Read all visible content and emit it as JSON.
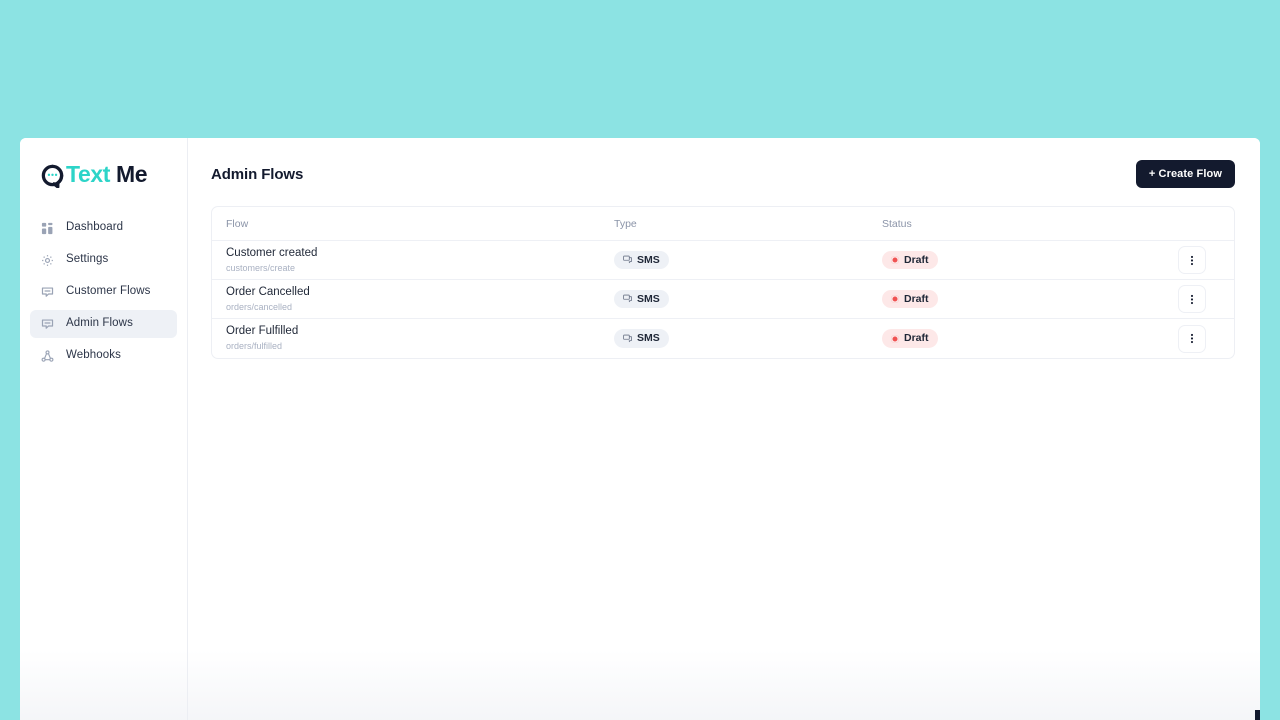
{
  "theme": {
    "background": "#8ce3e3",
    "accent_teal": "#2dd4c8",
    "dark_navy": "#131a2e",
    "status_red": "#f05252",
    "status_red_bg": "#fde8e8",
    "badge_bg": "#eef1f6"
  },
  "brand": {
    "name_part1": "Text",
    "name_part2": "Me",
    "logo_icon": "speech-bubble-icon"
  },
  "sidebar": {
    "items": [
      {
        "label": "Dashboard",
        "icon": "dashboard-grid-icon",
        "active": false
      },
      {
        "label": "Settings",
        "icon": "gear-icon",
        "active": false
      },
      {
        "label": "Customer Flows",
        "icon": "chat-flow-icon",
        "active": false
      },
      {
        "label": "Admin Flows",
        "icon": "chat-flow-icon",
        "active": true
      },
      {
        "label": "Webhooks",
        "icon": "share-nodes-icon",
        "active": false
      }
    ]
  },
  "header": {
    "title": "Admin Flows",
    "create_button": "+ Create Flow"
  },
  "table": {
    "columns": [
      "Flow",
      "Type",
      "Status"
    ],
    "rows": [
      {
        "flow_name": "Customer created",
        "flow_path": "customers/create",
        "type": "SMS",
        "type_icon": "device-chat-icon",
        "status": "Draft",
        "status_icon": "status-dot-icon",
        "action_icon": "kebab-menu-icon"
      },
      {
        "flow_name": "Order Cancelled",
        "flow_path": "orders/cancelled",
        "type": "SMS",
        "type_icon": "device-chat-icon",
        "status": "Draft",
        "status_icon": "status-dot-icon",
        "action_icon": "kebab-menu-icon"
      },
      {
        "flow_name": "Order Fulfilled",
        "flow_path": "orders/fulfilled",
        "type": "SMS",
        "type_icon": "device-chat-icon",
        "status": "Draft",
        "status_icon": "status-dot-icon",
        "action_icon": "kebab-menu-icon"
      }
    ]
  }
}
